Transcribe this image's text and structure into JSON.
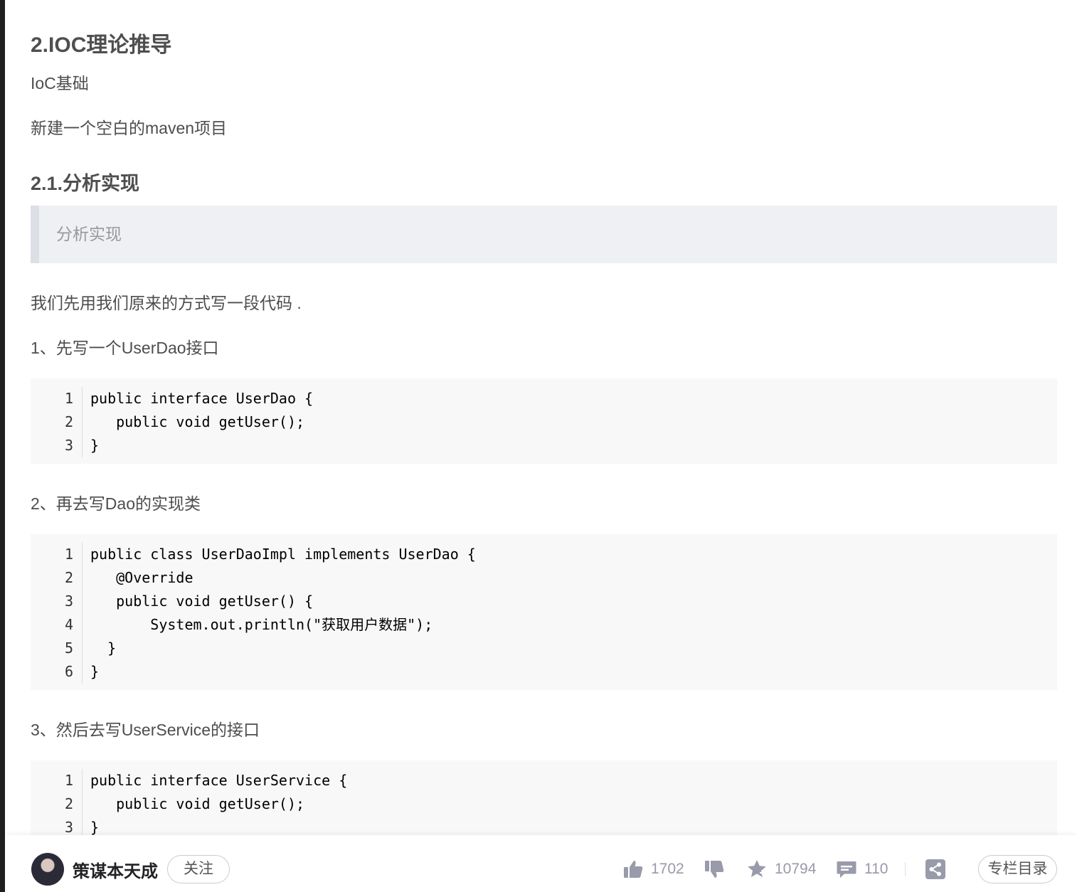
{
  "article": {
    "heading_2": "2.IOC理论推导",
    "para_ioc_basics": "IoC基础",
    "para_new_project": "新建一个空白的maven项目",
    "heading_2_1": "2.1.分析实现",
    "quote_text": "分析实现",
    "para_intro": "我们先用我们原来的方式写一段代码 .",
    "step1": "1、先写一个UserDao接口",
    "code1": {
      "line_numbers": [
        "1",
        "2",
        "3"
      ],
      "lines": [
        "public interface UserDao {",
        "   public void getUser();",
        "}"
      ]
    },
    "step2": "2、再去写Dao的实现类",
    "code2": {
      "line_numbers": [
        "1",
        "2",
        "3",
        "4",
        "5",
        "6"
      ],
      "lines": [
        "public class UserDaoImpl implements UserDao {",
        "   @Override",
        "   public void getUser() {",
        "       System.out.println(\"获取用户数据\");",
        "  }",
        "}"
      ]
    },
    "step3": "3、然后去写UserService的接口",
    "code3": {
      "line_numbers": [
        "1",
        "2",
        "3"
      ],
      "lines": [
        "public interface UserService {",
        "   public void getUser();",
        "}"
      ]
    }
  },
  "bottom_bar": {
    "author_name": "策谋本天成",
    "follow_label": "关注",
    "like_count": "1702",
    "collect_count": "10794",
    "comment_count": "110",
    "catalog_label": "专栏目录",
    "icons": [
      "thumbs-up-icon",
      "thumbs-down-icon",
      "star-icon",
      "comment-icon",
      "share-icon"
    ],
    "icon_color": "#999aaa"
  }
}
